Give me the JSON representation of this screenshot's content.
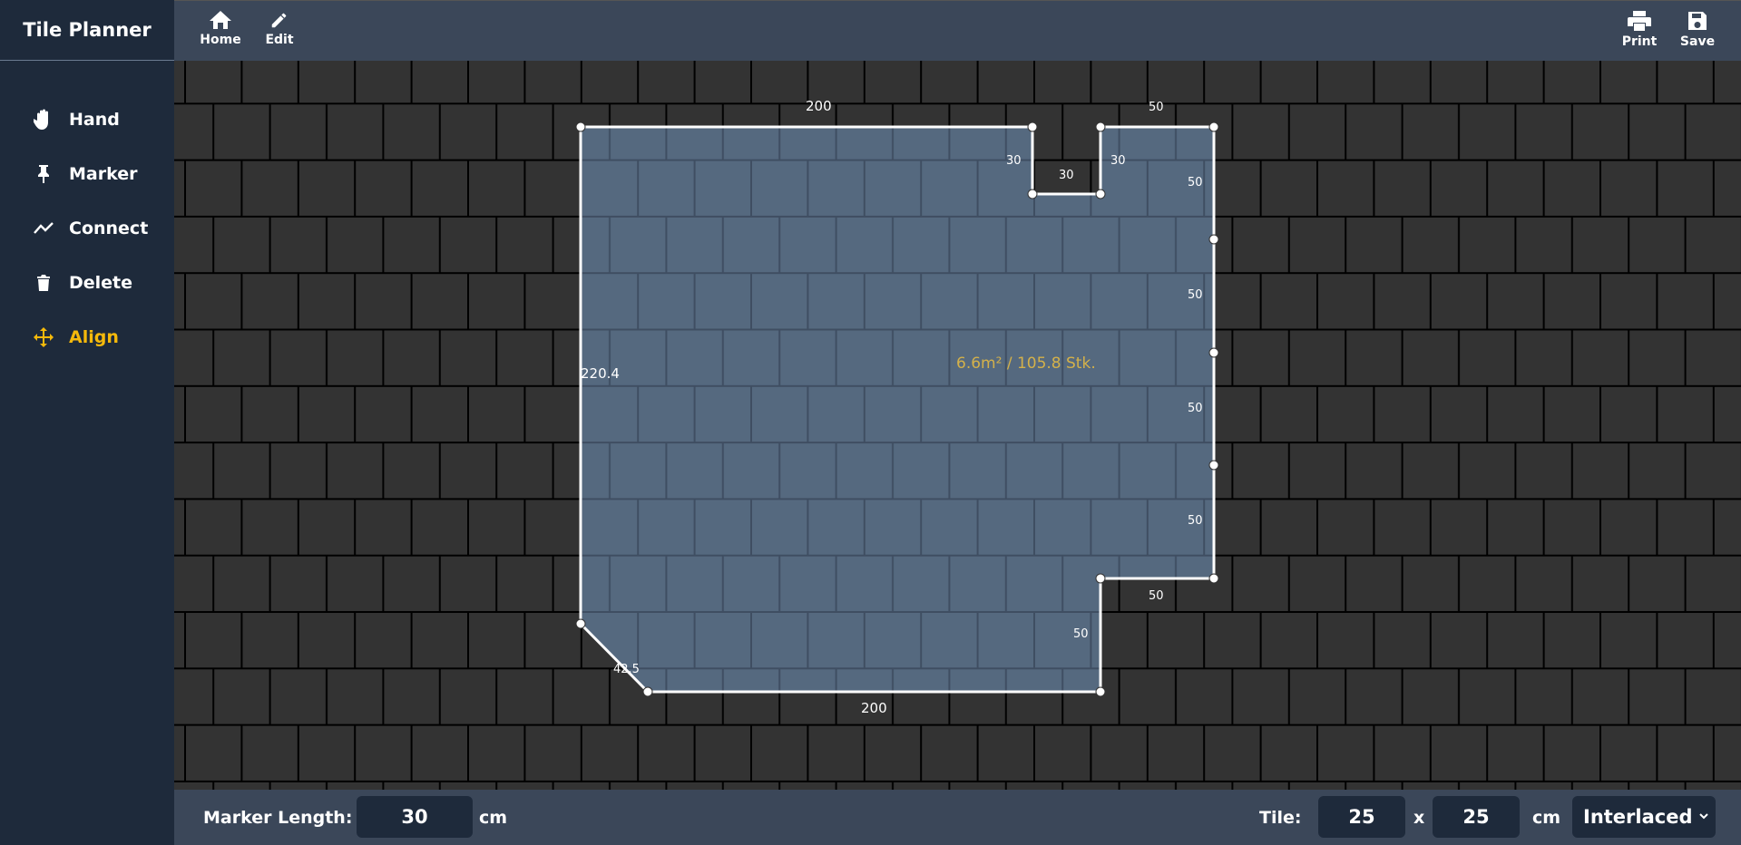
{
  "app": {
    "title": "Tile Planner"
  },
  "tools": [
    {
      "label": "Hand",
      "icon": "hand-icon",
      "active": false
    },
    {
      "label": "Marker",
      "icon": "pin-icon",
      "active": false
    },
    {
      "label": "Connect",
      "icon": "line-chart-icon",
      "active": false
    },
    {
      "label": "Delete",
      "icon": "trash-icon",
      "active": false
    },
    {
      "label": "Align",
      "icon": "move-arrows-icon",
      "active": true
    }
  ],
  "topbar": {
    "home_label": "Home",
    "edit_label": "Edit",
    "print_label": "Print",
    "save_label": "Save"
  },
  "plan": {
    "area_text": "6.6m² / 105.8 Stk.",
    "dimensions": [
      "200",
      "30",
      "30",
      "30",
      "50",
      "50",
      "50",
      "50",
      "50",
      "50",
      "50",
      "200",
      "42.5",
      "220.4"
    ]
  },
  "bottombar": {
    "marker_length_label": "Marker Length:",
    "marker_length_value": "30",
    "marker_unit": "cm",
    "tile_label": "Tile:",
    "tile_width": "25",
    "tile_x": "x",
    "tile_height": "25",
    "tile_unit": "cm",
    "pattern": "Interlaced"
  },
  "colors": {
    "sidebar_bg": "#1e2a3b",
    "topbar_bg": "#3b4759",
    "tile_fill": "#333333",
    "room_fill": "#55697f",
    "accent": "#f5b90b"
  }
}
